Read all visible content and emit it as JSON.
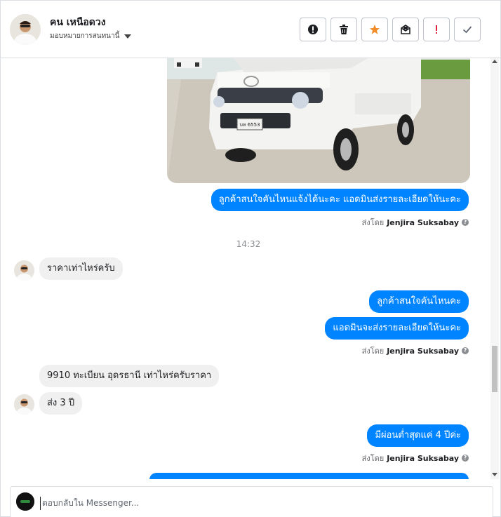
{
  "header": {
    "contact_name": "คน เหนือดวง",
    "assign_label": "มอบหมายการสนทนานี้",
    "action_buttons": [
      {
        "name": "spam-button",
        "icon": "exclamation-circle-icon"
      },
      {
        "name": "delete-button",
        "icon": "trash-icon"
      },
      {
        "name": "star-button",
        "icon": "star-icon"
      },
      {
        "name": "mark-unread-button",
        "icon": "envelope-icon"
      },
      {
        "name": "follow-up-button",
        "icon": "exclamation-icon"
      },
      {
        "name": "mark-done-button",
        "icon": "check-icon"
      }
    ]
  },
  "thread": {
    "photo_plate": "บห 6553",
    "messages": {
      "out1": "ลูกค้าสนใจคันไหนแจ้งได้นะคะ แอดมินส่งรายละเอียดให้นะคะ",
      "timestamp": "14:32",
      "in1": "ราคาเท่าไหร่ครับ",
      "out2": "ลูกค้าสนใจคันไหนคะ",
      "out3": "แอดมินจะส่งรายละเอียดให้นะคะ",
      "in2": "9910 ทะเบียน อุดรธานี เท่าไหร่ครับราคา",
      "in3": "ส่ง 3 ปี",
      "out4": "มีผ่อนต่ำสุดแค่ 4 ปีค่ะ"
    },
    "sent_by_prefix": "ส่งโดย",
    "sent_by_name": "Jenjira Suksabay",
    "help_mark": "?"
  },
  "composer": {
    "placeholder": "ตอบกลับใน Messenger..."
  },
  "colors": {
    "outgoing": "#0084ff",
    "incoming": "#f0f0f0",
    "star": "#f28c28",
    "alert": "#e41e3f"
  }
}
